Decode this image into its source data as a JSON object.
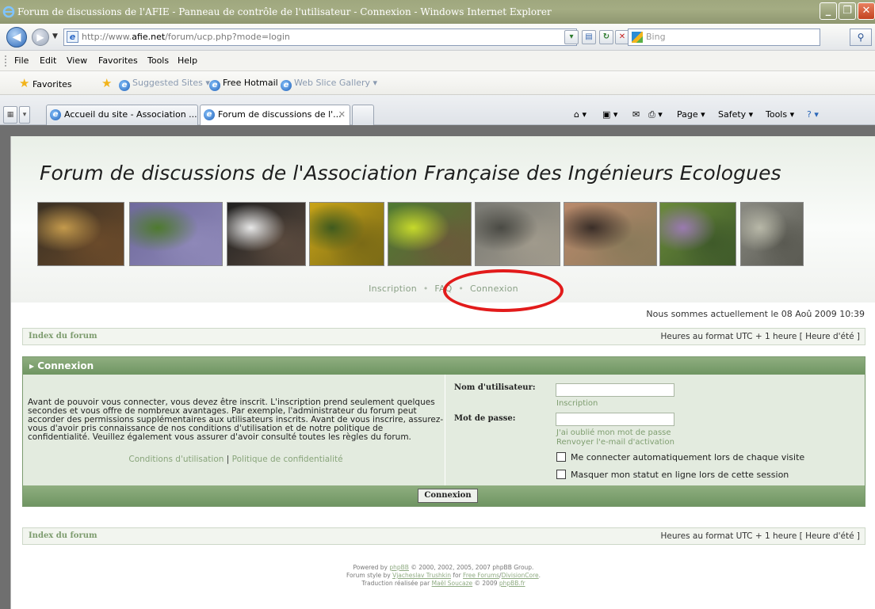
{
  "window": {
    "title": "Forum de discussions de l'AFIE - Panneau de contrôle de l'utilisateur - Connexion - Windows Internet Explorer",
    "buttons": [
      "minimize",
      "restore",
      "close"
    ]
  },
  "address": {
    "url_prefix": "http://www.",
    "url_domain": "afie.net",
    "url_path": "/forum/ucp.php?mode=login",
    "search_placeholder": "Bing"
  },
  "menu": [
    "File",
    "Edit",
    "View",
    "Favorites",
    "Tools",
    "Help"
  ],
  "favorites_bar": {
    "favorites_label": "Favorites",
    "items": [
      "Suggested Sites ▾",
      "Free Hotmail",
      "Web Slice Gallery ▾"
    ]
  },
  "tabs": [
    {
      "label": "Accueil du site - Association ...",
      "active": false
    },
    {
      "label": "Forum de discussions de l'...",
      "active": true
    }
  ],
  "command_bar": {
    "page_label": "Page ▾",
    "safety_label": "Safety ▾",
    "tools_label": "Tools ▾"
  },
  "page": {
    "site_title": "Forum de discussions de l'Association Française des Ingénieurs Ecologues",
    "photos": [
      {
        "name": "conference-photo",
        "colors": [
          "#3a3024",
          "#c49a4c",
          "#6a4a2a"
        ]
      },
      {
        "name": "gentian-flowers-photo",
        "colors": [
          "#6f6a9c",
          "#4e7a2e",
          "#8e88b8"
        ]
      },
      {
        "name": "bat-in-hand-photo",
        "colors": [
          "#202020",
          "#e8e8e8",
          "#5a4a3e"
        ]
      },
      {
        "name": "bee-on-flower-photo",
        "colors": [
          "#c9a418",
          "#3f5a1e",
          "#7a6a16"
        ]
      },
      {
        "name": "field-worker-photo",
        "colors": [
          "#4f7a32",
          "#c6d92b",
          "#6a5a3a"
        ]
      },
      {
        "name": "owl-nest-photo",
        "colors": [
          "#7a7a74",
          "#4a4a44",
          "#a09a8c"
        ]
      },
      {
        "name": "salamander-hand-photo",
        "colors": [
          "#b98a6c",
          "#3a2e28",
          "#8a7a5a"
        ]
      },
      {
        "name": "butterfly-flowers-photo",
        "colors": [
          "#6a8a3a",
          "#9a7ab0",
          "#3f5a2a"
        ]
      },
      {
        "name": "lichen-photo",
        "colors": [
          "#8a8a82",
          "#b8b8a8",
          "#5a5a52"
        ]
      }
    ],
    "nav": {
      "inscription": "Inscription",
      "sep": "•",
      "faq": "FAQ",
      "connexion": "Connexion"
    },
    "current_date": "Nous sommes actuellement le 08 Aoû 2009 10:39",
    "breadcrumb": {
      "index_label": "Index du forum",
      "timezone": "Heures au format UTC + 1 heure [ Heure d'été ]"
    },
    "login_panel": {
      "heading": "▸ Connexion",
      "intro": "Avant de pouvoir vous connecter, vous devez être inscrit. L'inscription prend seulement quelques secondes et vous offre de nombreux avantages. Par exemple, l'administrateur du forum peut accorder des permissions supplémentaires aux utilisateurs inscrits. Avant de vous inscrire, assurez-vous d'avoir pris connaissance de nos conditions d'utilisation et de notre politique de confidentialité. Veuillez également vous assurer d'avoir consulté toutes les règles du forum.",
      "terms_link": "Conditions d'utilisation",
      "pipe": "|",
      "privacy_link": "Politique de confidentialité",
      "username_label": "Nom d'utilisateur:",
      "username_value": "",
      "register_link": "Inscription",
      "password_label": "Mot de passe:",
      "password_value": "",
      "forgot_link": "J'ai oublié mon mot de passe",
      "resend_link": "Renvoyer l'e-mail d'activation",
      "autologin_label": "Me connecter automatiquement lors de chaque visite",
      "hide_status_label": "Masquer mon statut en ligne lors de cette session",
      "submit_label": "Connexion"
    },
    "footer": {
      "line1_pre": "Powered by ",
      "line1_link": "phpBB",
      "line1_post": " © 2000, 2002, 2005, 2007 phpBB Group.",
      "line2_pre": "Forum style by ",
      "line2_link1": "Vjacheslav Trushkin",
      "line2_mid1": " for ",
      "line2_link2": "Free Forums",
      "line2_mid2": "/",
      "line2_link3": "DivisionCore",
      "line2_post": ".",
      "line3_pre": "Traduction réalisée par ",
      "line3_link1": "Maël Soucaze",
      "line3_mid": " © 2009 ",
      "line3_link2": "phpBB.fr"
    }
  },
  "colors": {
    "titlebar": "#9fa77e",
    "panel_header": "#7fa070",
    "panel_body": "#e3ebdf",
    "link": "#88a47a",
    "annotation_circle": "#e21b1b"
  }
}
